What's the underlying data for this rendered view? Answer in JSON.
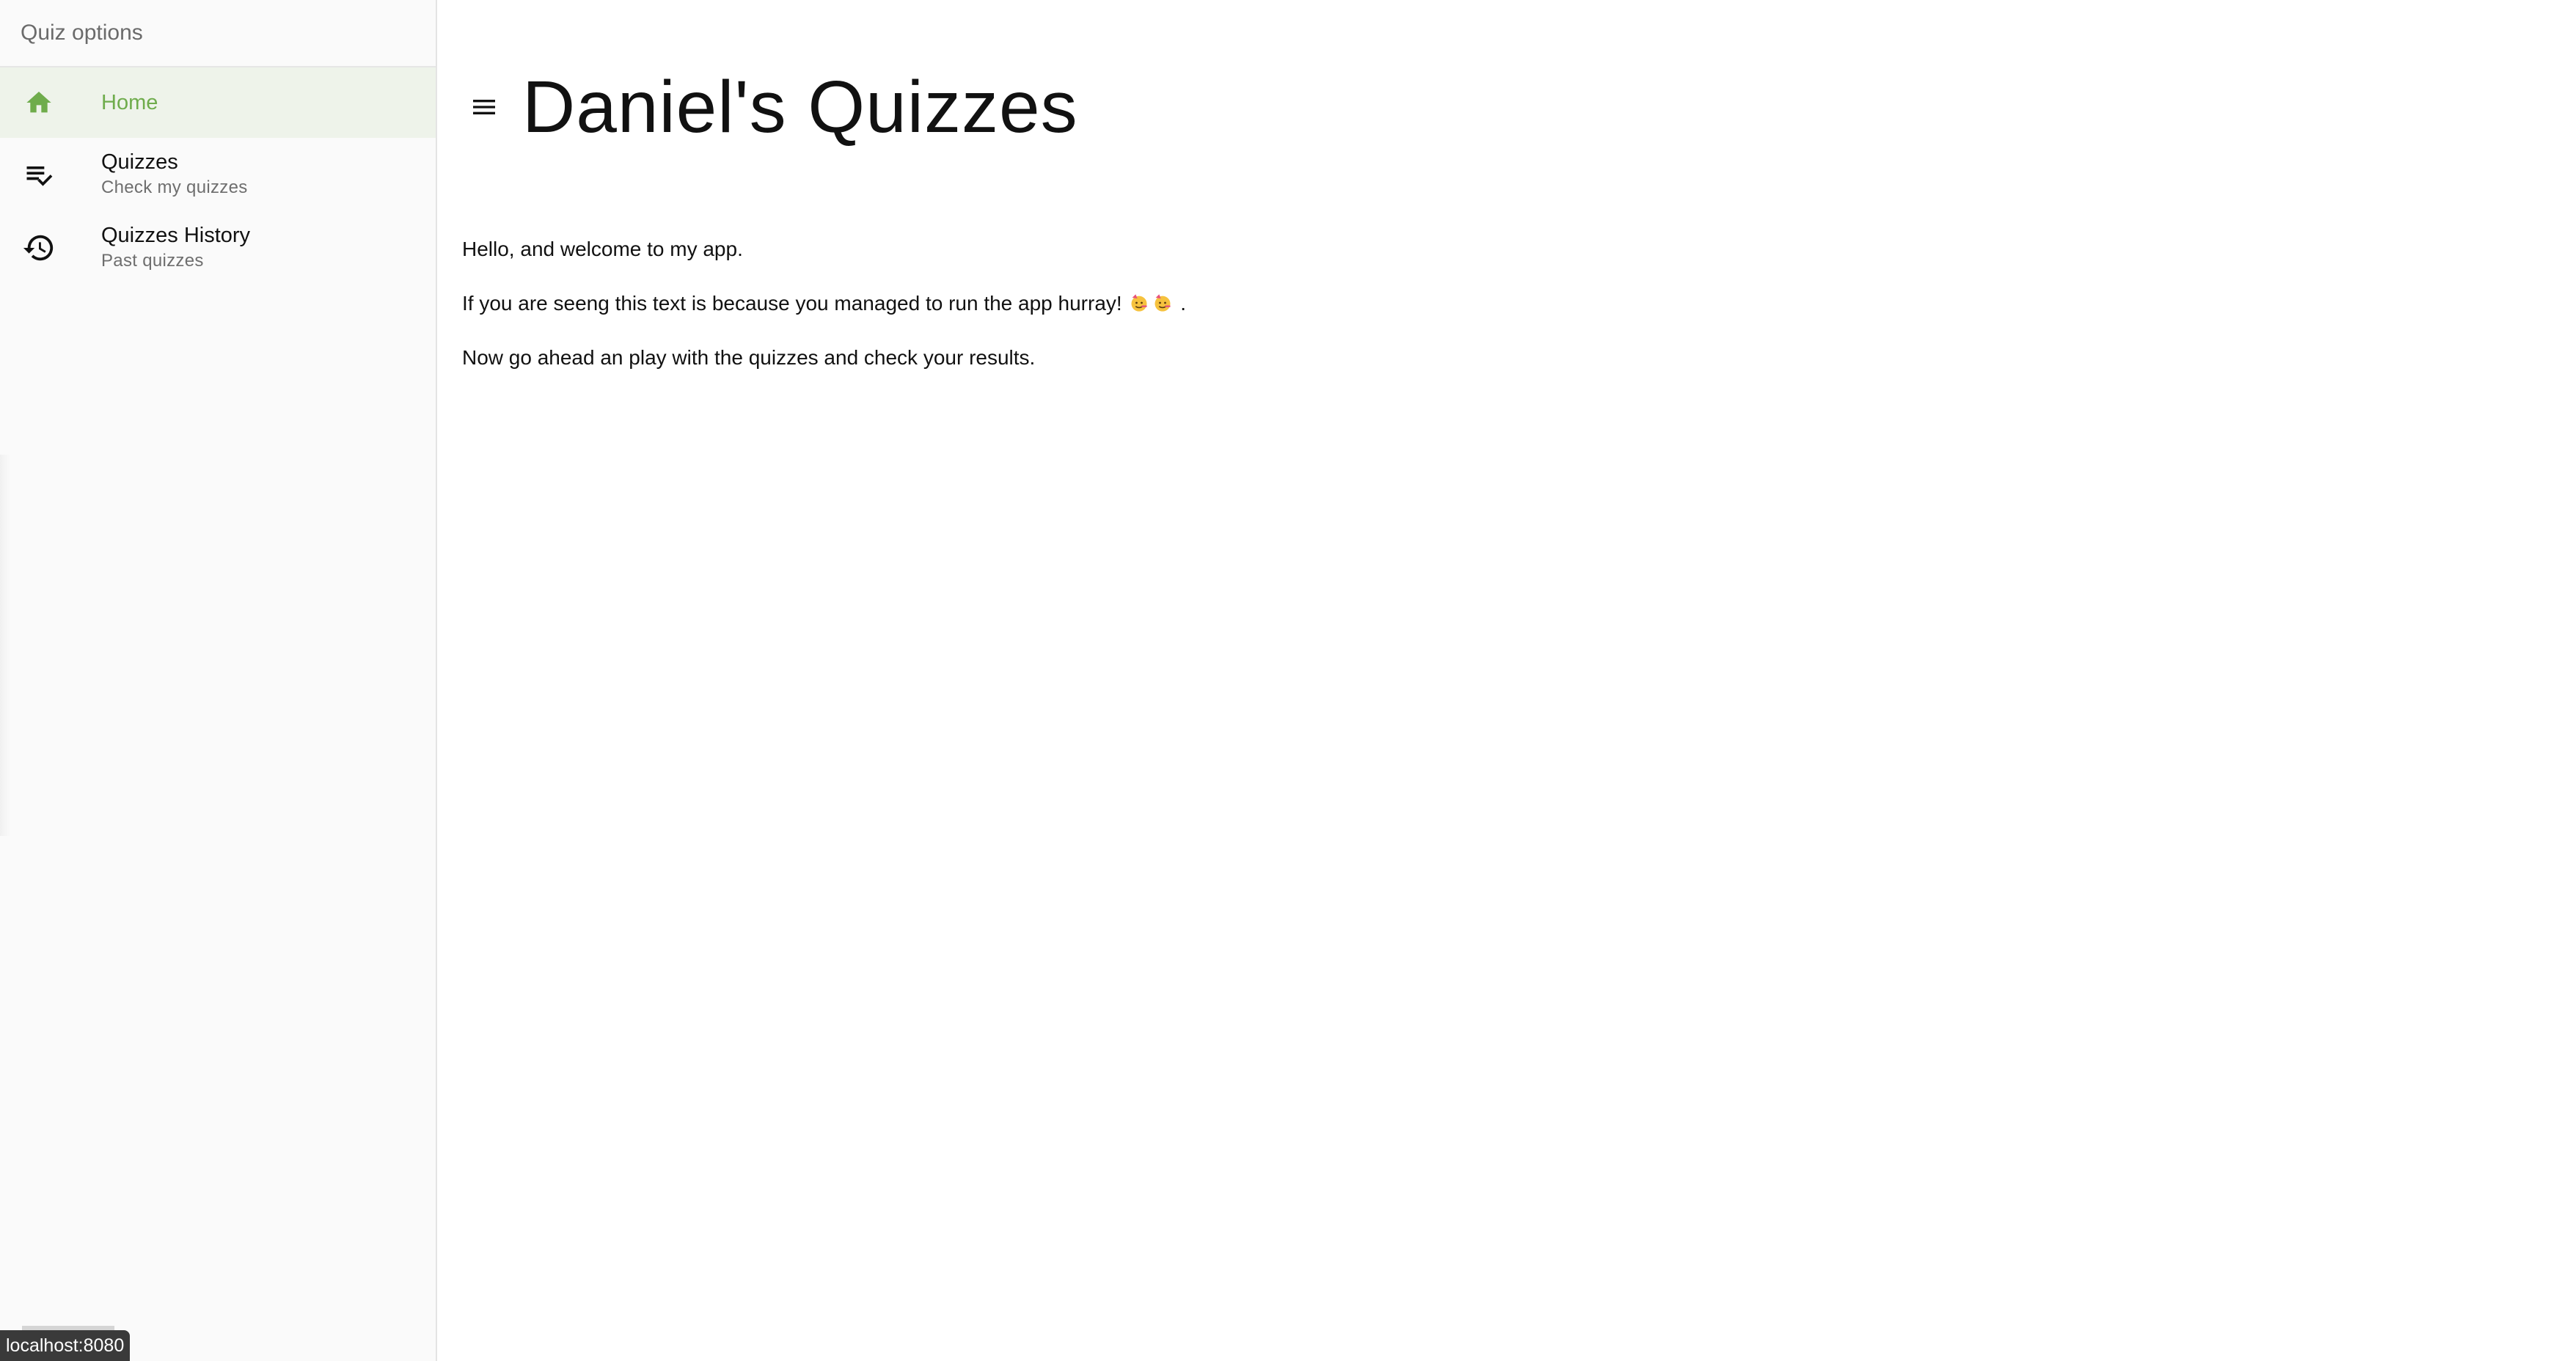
{
  "drawer": {
    "title": "Quiz options",
    "items": [
      {
        "label": "Home",
        "subtitle": "",
        "icon": "home-icon",
        "active": true
      },
      {
        "label": "Quizzes",
        "subtitle": "Check my quizzes",
        "icon": "playlist-check-icon",
        "active": false
      },
      {
        "label": "Quizzes History",
        "subtitle": "Past quizzes",
        "icon": "history-icon",
        "active": false
      }
    ]
  },
  "header": {
    "title": "Daniel's Quizzes",
    "menu_icon": "hamburger-menu-icon"
  },
  "content": {
    "line1": "Hello, and welcome to my app.",
    "line2_before": "If you are seeng this text is because you managed to run the app hurray!",
    "line2_after": ".",
    "line2_emoji": "party-face-emoji",
    "line3": "Now go ahead an play with the quizzes and check your results."
  },
  "status_bar": {
    "url": "localhost:8080"
  },
  "colors": {
    "accent": "#6fac4c",
    "active_bg": "#eef3ea",
    "drawer_bg": "#fafafa"
  }
}
